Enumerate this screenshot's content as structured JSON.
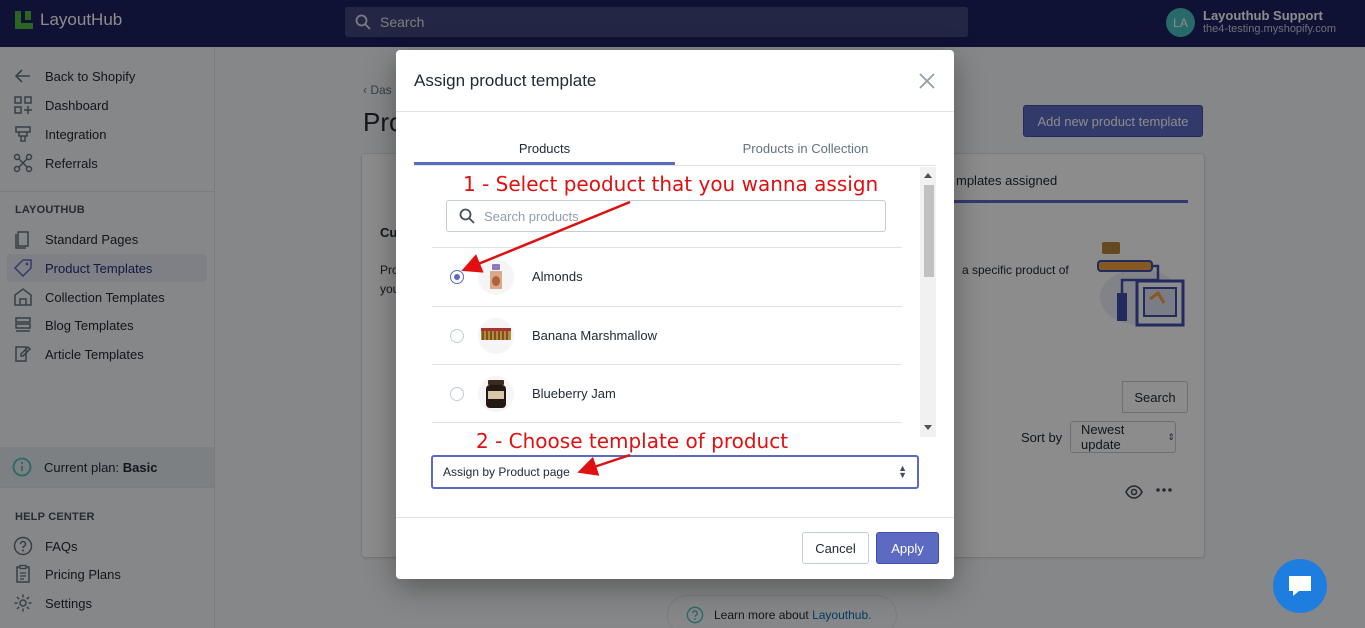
{
  "app": {
    "brand": "LayoutHub",
    "search_placeholder": "Search"
  },
  "user": {
    "initials": "LA",
    "name": "Layouthub Support",
    "shop": "the4-testing.myshopify.com"
  },
  "sidebar": {
    "top_items": [
      {
        "label": "Back to Shopify",
        "icon": "arrow-left-icon"
      },
      {
        "label": "Dashboard",
        "icon": "dashboard-icon"
      },
      {
        "label": "Integration",
        "icon": "integration-icon"
      },
      {
        "label": "Referrals",
        "icon": "referrals-icon"
      }
    ],
    "section_layouthub": "LAYOUTHUB",
    "layouthub_items": [
      {
        "label": "Standard Pages",
        "icon": "pages-icon"
      },
      {
        "label": "Product Templates",
        "icon": "tag-icon",
        "active": true
      },
      {
        "label": "Collection Templates",
        "icon": "collection-icon"
      },
      {
        "label": "Blog Templates",
        "icon": "blog-icon"
      },
      {
        "label": "Article Templates",
        "icon": "article-icon"
      }
    ],
    "plan_label": "Current plan: ",
    "plan_value": "Basic",
    "section_help": "HELP CENTER",
    "help_items": [
      {
        "label": "FAQs",
        "icon": "question-icon"
      },
      {
        "label": "Pricing Plans",
        "icon": "clipboard-icon"
      },
      {
        "label": "Settings",
        "icon": "gear-icon"
      }
    ]
  },
  "page": {
    "breadcrumb": "Das",
    "title": "Pro",
    "add_button": "Add new product template",
    "tab_partial": "mplates assigned",
    "card_heading_partial": "Cu",
    "card_text_1": "Pro",
    "card_text_2": "you",
    "card_text_right": "a specific product of",
    "search_button": "Search",
    "sort_by": "Sort by",
    "sort_value": "Newest update",
    "learn_prefix": "Learn more about ",
    "learn_link": "Layouthub."
  },
  "modal": {
    "title": "Assign product template",
    "tabs": [
      "Products",
      "Products in Collection"
    ],
    "search_placeholder": "Search products",
    "products": [
      {
        "name": "Almonds",
        "selected": true
      },
      {
        "name": "Banana Marshmallow",
        "selected": false
      },
      {
        "name": "Blueberry Jam",
        "selected": false
      }
    ],
    "select_value": "Assign by Product page",
    "cancel": "Cancel",
    "apply": "Apply"
  },
  "annotations": {
    "step1": "1 - Select peoduct that you wanna assign",
    "step2": "2 - Choose template of product"
  },
  "colors": {
    "topbar": "#1c2260",
    "accent": "#5c6ac4",
    "annotation": "#e01010",
    "chat": "#1e7ee0"
  }
}
